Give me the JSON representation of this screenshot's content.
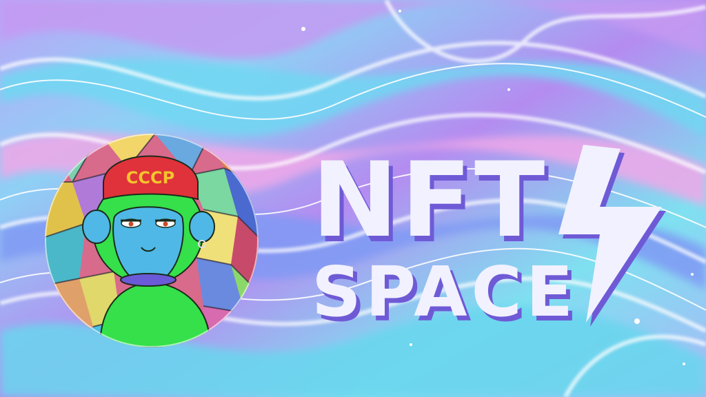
{
  "banner": {
    "title_line1": "NFT",
    "title_line2": "SPACE",
    "cap_text": "CCCP"
  },
  "colors": {
    "bg_purple": "#b07cf0",
    "bg_cyan": "#5fd4f0",
    "bg_pink": "#f2a6e6",
    "bg_blue": "#6f8cf2",
    "title_fill": "#f2f1ff",
    "title_shadow": "#6f5ad6",
    "ape_skin": "#35e04a",
    "ape_face": "#4fb8e6",
    "cap_red": "#e0323a",
    "cap_text": "#f3c42e"
  },
  "icons": {
    "bolt": "lightning-bolt-icon",
    "avatar": "ape-avatar"
  }
}
